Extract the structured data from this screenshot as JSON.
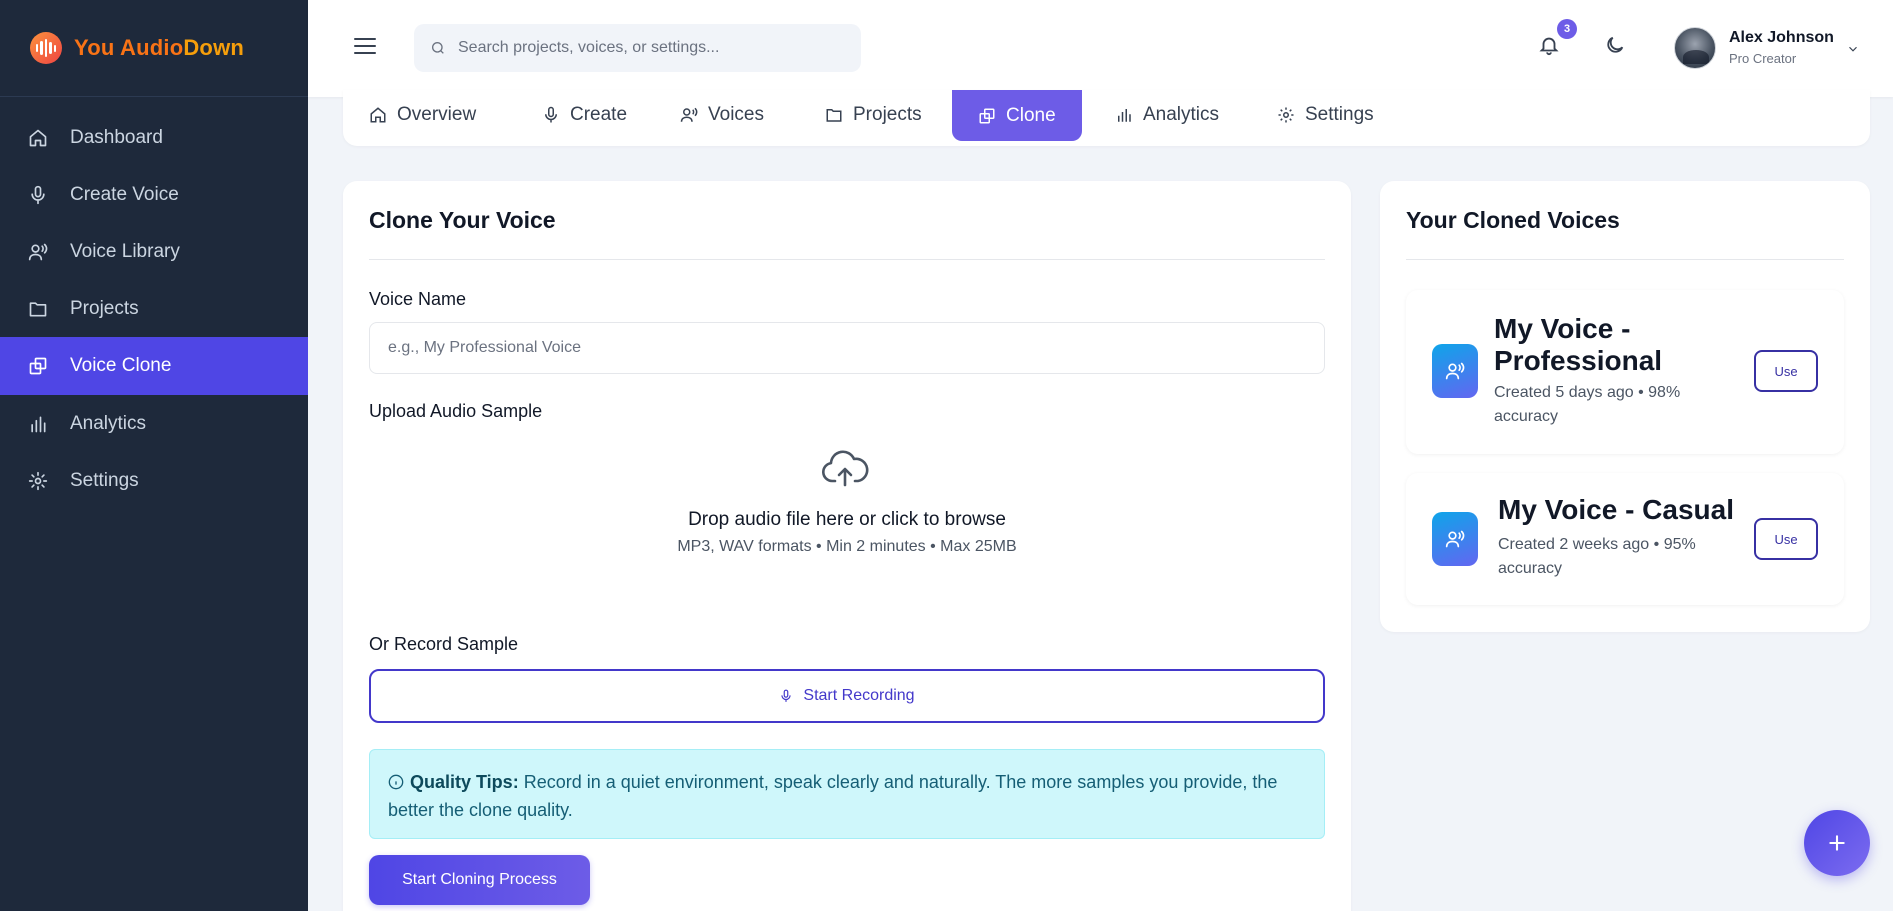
{
  "brand": {
    "name_part1": "You Audio",
    "name_part2": "Down"
  },
  "sidebar": {
    "items": [
      {
        "label": "Dashboard",
        "icon": "home-icon"
      },
      {
        "label": "Create Voice",
        "icon": "microphone-icon"
      },
      {
        "label": "Voice Library",
        "icon": "voice-icon"
      },
      {
        "label": "Projects",
        "icon": "folder-icon"
      },
      {
        "label": "Voice Clone",
        "icon": "clone-icon",
        "active": true
      },
      {
        "label": "Analytics",
        "icon": "bar-chart-icon"
      },
      {
        "label": "Settings",
        "icon": "gear-icon"
      }
    ]
  },
  "header": {
    "search_placeholder": "Search projects, voices, or settings...",
    "notification_count": "3",
    "user_name": "Alex Johnson",
    "user_role": "Pro Creator"
  },
  "tabs": [
    {
      "label": "Overview",
      "icon": "home-icon"
    },
    {
      "label": "Create",
      "icon": "microphone-icon"
    },
    {
      "label": "Voices",
      "icon": "voice-icon"
    },
    {
      "label": "Projects",
      "icon": "folder-icon"
    },
    {
      "label": "Clone",
      "icon": "clone-icon",
      "active": true
    },
    {
      "label": "Analytics",
      "icon": "bar-chart-icon"
    },
    {
      "label": "Settings",
      "icon": "gear-icon"
    }
  ],
  "clone_form": {
    "title": "Clone Your Voice",
    "voice_name_label": "Voice Name",
    "voice_name_placeholder": "e.g., My Professional Voice",
    "upload_label": "Upload Audio Sample",
    "upload_main": "Drop audio file here or click to browse",
    "upload_sub": "MP3, WAV formats • Min 2 minutes • Max 25MB",
    "record_label": "Or Record Sample",
    "record_button": "Start Recording",
    "tips_title": "Quality Tips:",
    "tips_text": " Record in a quiet environment, speak clearly and naturally. The more samples you provide, the better the clone quality.",
    "submit_button": "Start Cloning Process"
  },
  "cloned_voices": {
    "title": "Your Cloned Voices",
    "items": [
      {
        "name": "My Voice - Professional",
        "meta": "Created 5 days ago • 98% accuracy",
        "action": "Use"
      },
      {
        "name": "My Voice - Casual",
        "meta": "Created 2 weeks ago • 95% accuracy",
        "action": "Use"
      }
    ]
  },
  "colors": {
    "sidebar_bg": "#1e293b",
    "accent": "#4f46e5",
    "brand_orange": "#f97316",
    "tips_bg": "#cff7fb"
  }
}
